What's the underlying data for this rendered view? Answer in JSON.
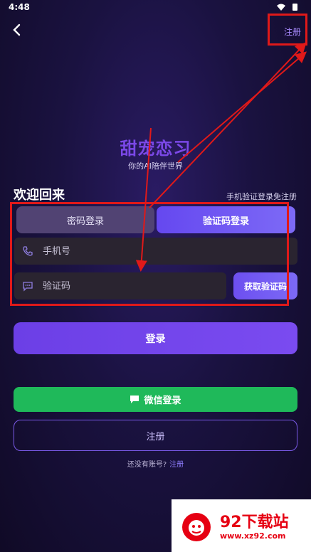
{
  "status": {
    "time": "4:48"
  },
  "header": {
    "register_label": "注册"
  },
  "brand": {
    "title": "甜宠恋习",
    "subtitle": "你的AI陪伴世界"
  },
  "welcome": {
    "title": "欢迎回来",
    "hint": "手机验证登录免注册"
  },
  "tabs": {
    "password": "密码登录",
    "code": "验证码登录"
  },
  "form": {
    "phone_placeholder": "手机号",
    "code_placeholder": "验证码",
    "get_code_label": "获取验证码"
  },
  "actions": {
    "login": "登录",
    "wechat": "微信登录",
    "register": "注册"
  },
  "footer": {
    "prompt": "还没有账号?",
    "link": "注册"
  },
  "watermark": {
    "name": "92下载站",
    "url": "www.xz92.com"
  },
  "colors": {
    "accent": "#7b48e8",
    "wechat": "#1fb95a",
    "annotation": "#e01919"
  }
}
